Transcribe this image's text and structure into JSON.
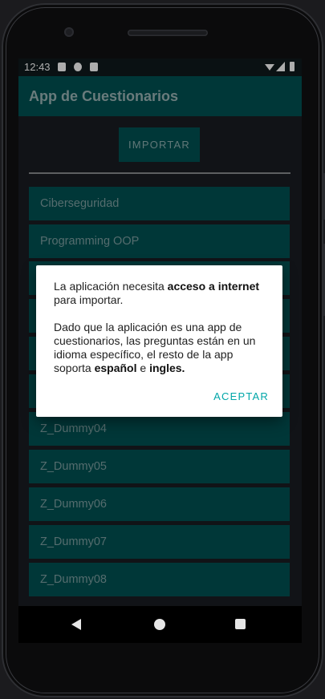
{
  "status": {
    "time": "12:43"
  },
  "appbar": {
    "title": "App de Cuestionarios"
  },
  "import_button": {
    "label": "IMPORTAR"
  },
  "list": {
    "items": [
      "Ciberseguridad",
      "Programming OOP",
      "",
      "",
      "",
      "",
      "Z_Dummy04",
      "Z_Dummy05",
      "Z_Dummy06",
      "Z_Dummy07",
      "Z_Dummy08"
    ]
  },
  "dialog": {
    "p1_text1": "La aplicación necesita ",
    "p1_bold": "acceso a internet",
    "p1_text2": " para importar.",
    "p2_text1": "Dado que la aplicación es una app de cuestionarios, las preguntas están en un idioma específico, el resto de la app soporta ",
    "p2_bold1": "español",
    "p2_text2": " e ",
    "p2_bold2": "ingles.",
    "accept_label": "ACEPTAR"
  },
  "colors": {
    "primary": "#005253",
    "background": "#1a1c22",
    "accent": "#00a6a8",
    "dialog": "#ffffff"
  },
  "icons": {
    "status_left": [
      "notification-a-icon",
      "notification-p-icon",
      "sd-card-icon"
    ],
    "status_right": [
      "wifi-icon",
      "signal-icon",
      "battery-icon"
    ],
    "navigation": [
      "back-icon",
      "home-icon",
      "recents-icon"
    ]
  }
}
